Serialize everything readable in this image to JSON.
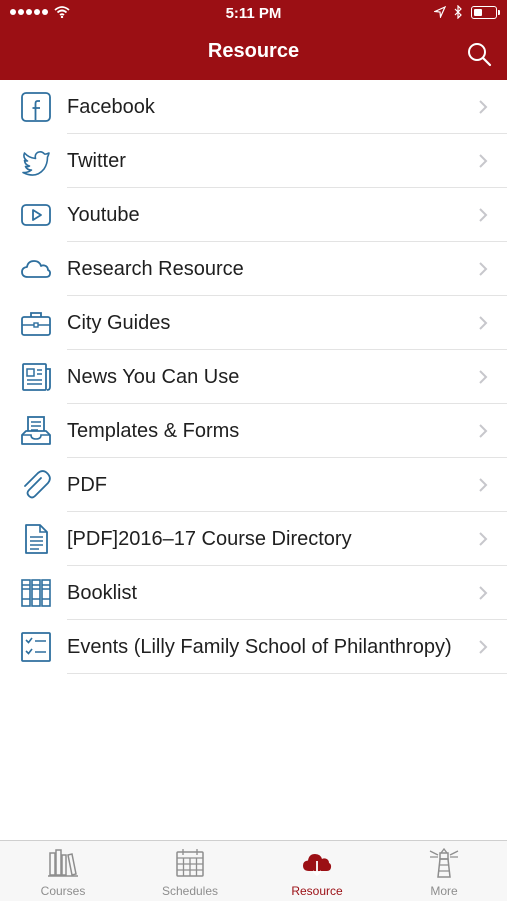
{
  "status_bar": {
    "time": "5:11 PM"
  },
  "nav": {
    "title": "Resource"
  },
  "list": {
    "items": [
      {
        "label": "Facebook",
        "icon": "facebook-icon"
      },
      {
        "label": "Twitter",
        "icon": "twitter-icon"
      },
      {
        "label": "Youtube",
        "icon": "youtube-icon"
      },
      {
        "label": "Research Resource",
        "icon": "cloud-icon"
      },
      {
        "label": "City Guides",
        "icon": "briefcase-icon"
      },
      {
        "label": "News You Can Use",
        "icon": "newspaper-icon"
      },
      {
        "label": "Templates & Forms",
        "icon": "forms-tray-icon"
      },
      {
        "label": "PDF",
        "icon": "paperclip-icon"
      },
      {
        "label": "[PDF]2016–17 Course Directory",
        "icon": "document-icon"
      },
      {
        "label": "Booklist",
        "icon": "books-icon"
      },
      {
        "label": "Events (Lilly Family School of Philanthropy)",
        "icon": "checklist-icon"
      }
    ]
  },
  "tabbar": {
    "tabs": [
      {
        "label": "Courses",
        "icon": "books-shelf-icon",
        "active": false
      },
      {
        "label": "Schedules",
        "icon": "calendar-icon",
        "active": false
      },
      {
        "label": "Resource",
        "icon": "cloud-download-icon",
        "active": true
      },
      {
        "label": "More",
        "icon": "lighthouse-icon",
        "active": false
      }
    ]
  },
  "colors": {
    "brand": "#9b0f14",
    "icon_blue": "#2e6f9e",
    "tab_inactive": "#8e8e8e"
  }
}
